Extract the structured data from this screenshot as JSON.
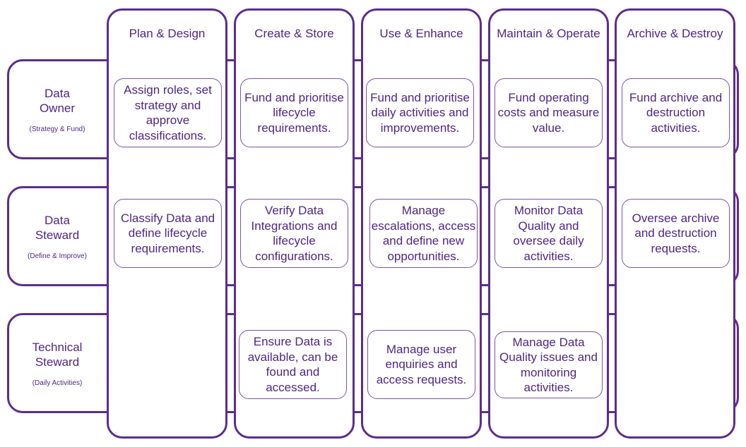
{
  "colors": {
    "stroke": "#5b2d8e",
    "text": "#4f2683"
  },
  "rows": [
    {
      "title": "Data Owner",
      "subtitle": "(Strategy & Fund)"
    },
    {
      "title": "Data Steward",
      "subtitle": "(Define & Improve)"
    },
    {
      "title": "Technical Steward",
      "subtitle": "(Daily Activities)"
    }
  ],
  "columns": [
    "Plan & Design",
    "Create & Store",
    "Use & Enhance",
    "Maintain & Operate",
    "Archive & Destroy"
  ],
  "cells": {
    "owner": [
      "Assign roles, set strategy and approve classifications.",
      "Fund and prioritise lifecycle requirements.",
      "Fund and prioritise daily activities and improvements.",
      "Fund operating costs and measure value.",
      "Fund archive and destruction activities."
    ],
    "steward": [
      "Classify Data and define lifecycle requirements.",
      "Verify Data Integrations and lifecycle configurations.",
      "Manage escalations, access and define new opportunities.",
      "Monitor Data Quality and oversee daily activities.",
      "Oversee archive and destruction requests."
    ],
    "technical": [
      "",
      "Ensure Data is available, can be found and accessed.",
      "Manage user enquiries and access requests.",
      "Manage Data Quality issues and monitoring activities.",
      ""
    ]
  }
}
